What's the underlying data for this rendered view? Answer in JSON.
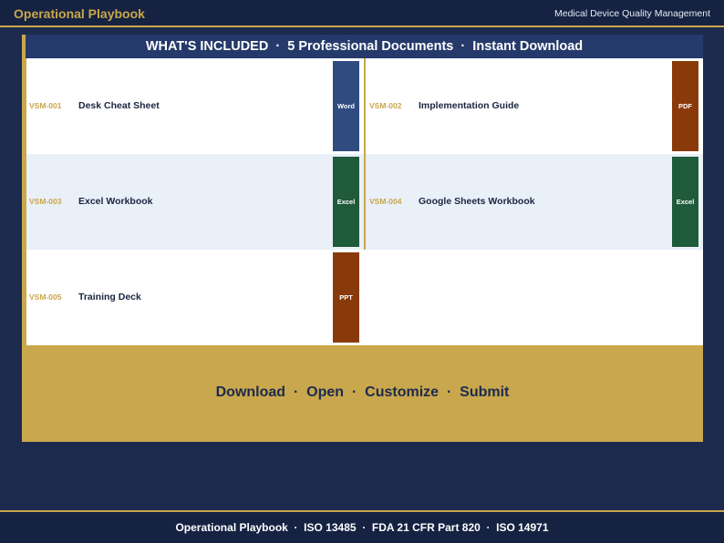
{
  "header": {
    "brand": "Operational Playbook",
    "tagline": "Medical Device Quality Management"
  },
  "panel": {
    "heading": "WHAT'S INCLUDED  ·  5 Professional Documents  ·  Instant Download",
    "documents": [
      {
        "code": "VSM-001",
        "title": "Desk Cheat Sheet",
        "format": "Word"
      },
      {
        "code": "VSM-002",
        "title": "Implementation Guide",
        "format": "PDF"
      },
      {
        "code": "VSM-003",
        "title": "Excel Workbook",
        "format": "Excel"
      },
      {
        "code": "VSM-004",
        "title": "Google Sheets Workbook",
        "format": "Excel"
      },
      {
        "code": "VSM-005",
        "title": "Training Deck",
        "format": "PPT"
      }
    ],
    "workflow": "Download  ·  Open  ·  Customize  ·  Submit"
  },
  "footer": {
    "text": "Operational Playbook  ·  ISO 13485  ·  FDA 21 CFR Part 820  ·  ISO 14971"
  },
  "colors": {
    "navy": "#1c2a4e",
    "gold": "#c9a74c",
    "word": "#2f4b80",
    "pdf": "#8a3a0a",
    "excel": "#1f5a3a",
    "ppt": "#8a3a0a"
  }
}
